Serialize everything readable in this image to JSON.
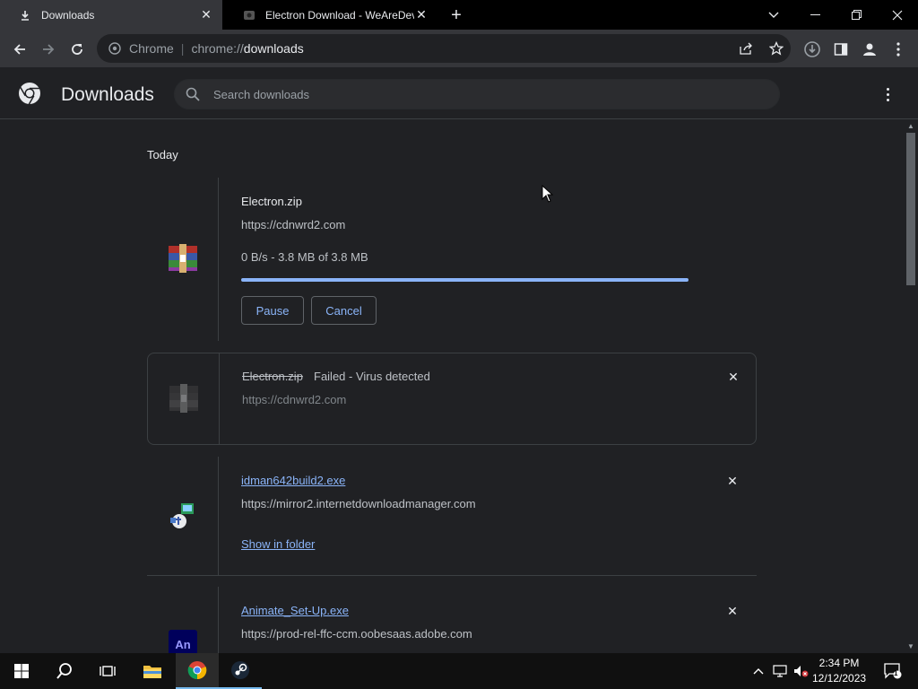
{
  "tabs": [
    {
      "label": "Downloads",
      "icon": "download-icon"
    },
    {
      "label": "Electron Download - WeAreDevs",
      "icon": "site-favicon"
    }
  ],
  "omnibox": {
    "scheme": "Chrome",
    "path_prefix": "chrome://",
    "path": "downloads"
  },
  "page": {
    "title": "Downloads",
    "search_placeholder": "Search downloads"
  },
  "date_header": "Today",
  "downloads": [
    {
      "name": "Electron.zip",
      "url": "https://cdnwrd2.com",
      "status": "0 B/s - 3.8 MB of 3.8 MB",
      "progress": 1.0,
      "pause_label": "Pause",
      "cancel_label": "Cancel",
      "icon": "winrar-icon"
    },
    {
      "name": "Electron.zip",
      "failed_text": "Failed - Virus detected",
      "url": "https://cdnwrd2.com",
      "icon": "winrar-icon"
    },
    {
      "name": "idman642build2.exe",
      "url": "https://mirror2.internetdownloadmanager.com",
      "show_folder_label": "Show in folder",
      "icon": "idm-installer-icon"
    },
    {
      "name": "Animate_Set-Up.exe",
      "url": "https://prod-rel-ffc-ccm.oobesaas.adobe.com",
      "icon": "adobe-animate-icon",
      "icon_text": "An"
    }
  ],
  "taskbar": {
    "time": "2:34 PM",
    "date": "12/12/2023",
    "notification_count": "1"
  },
  "colors": {
    "accent": "#8ab4f8",
    "background": "#202124",
    "toolbar": "#35363a"
  }
}
